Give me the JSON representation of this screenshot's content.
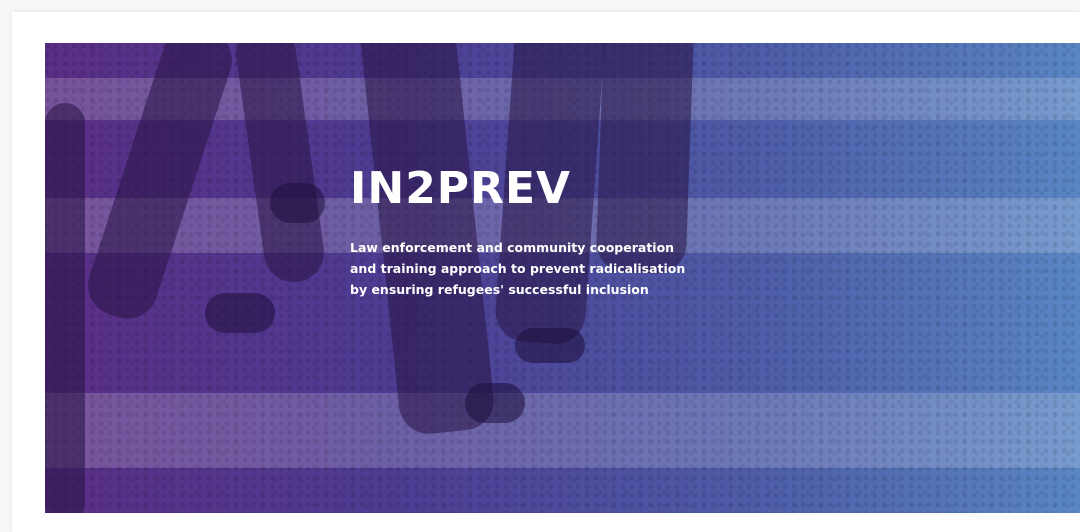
{
  "hero": {
    "title": "IN2PREV",
    "subtitle_lines": [
      "Law enforcement and community cooperation",
      "and training approach to prevent radicalisation",
      "by ensuring refugees' successful inclusion"
    ],
    "gradient_start": "#5a2e86",
    "gradient_end": "#5a86c4",
    "text_color": "#ffffff"
  }
}
